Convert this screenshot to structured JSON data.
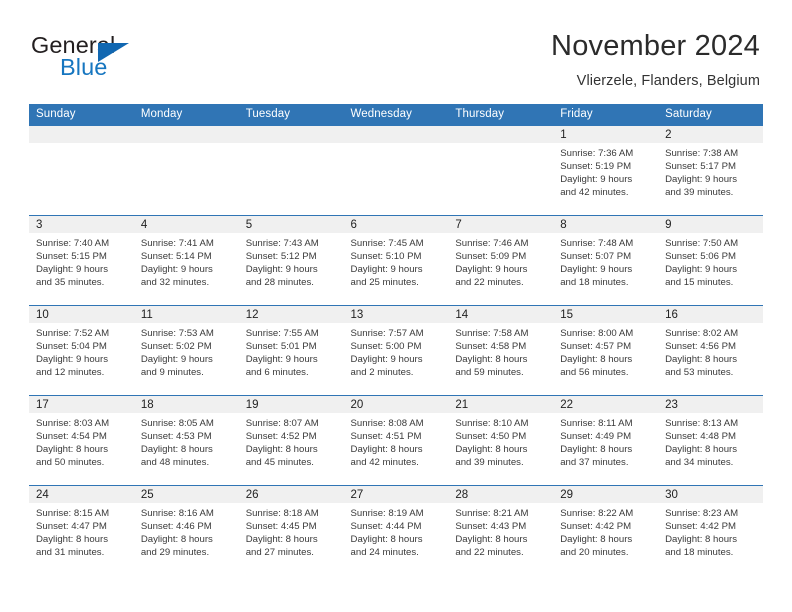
{
  "brand": {
    "name_top": "General",
    "name_bottom": "Blue",
    "triangle_icon": "blue-triangle-icon",
    "accent_color": "#1676c0"
  },
  "header": {
    "title": "November 2024",
    "location": "Vlierzele, Flanders, Belgium"
  },
  "theme": {
    "header_blue": "#3075b5",
    "day_band_gray": "#f0f0f0",
    "text_dark": "#231f20"
  },
  "calendar": {
    "weekday_headers": [
      "Sunday",
      "Monday",
      "Tuesday",
      "Wednesday",
      "Thursday",
      "Friday",
      "Saturday"
    ],
    "labels": {
      "sunrise": "Sunrise:",
      "sunset": "Sunset:",
      "daylight": "Daylight:"
    },
    "weeks": [
      [
        {
          "day": "",
          "lines": []
        },
        {
          "day": "",
          "lines": []
        },
        {
          "day": "",
          "lines": []
        },
        {
          "day": "",
          "lines": []
        },
        {
          "day": "",
          "lines": []
        },
        {
          "day": "1",
          "lines": [
            "Sunrise: 7:36 AM",
            "Sunset: 5:19 PM",
            "Daylight: 9 hours",
            "and 42 minutes."
          ]
        },
        {
          "day": "2",
          "lines": [
            "Sunrise: 7:38 AM",
            "Sunset: 5:17 PM",
            "Daylight: 9 hours",
            "and 39 minutes."
          ]
        }
      ],
      [
        {
          "day": "3",
          "lines": [
            "Sunrise: 7:40 AM",
            "Sunset: 5:15 PM",
            "Daylight: 9 hours",
            "and 35 minutes."
          ]
        },
        {
          "day": "4",
          "lines": [
            "Sunrise: 7:41 AM",
            "Sunset: 5:14 PM",
            "Daylight: 9 hours",
            "and 32 minutes."
          ]
        },
        {
          "day": "5",
          "lines": [
            "Sunrise: 7:43 AM",
            "Sunset: 5:12 PM",
            "Daylight: 9 hours",
            "and 28 minutes."
          ]
        },
        {
          "day": "6",
          "lines": [
            "Sunrise: 7:45 AM",
            "Sunset: 5:10 PM",
            "Daylight: 9 hours",
            "and 25 minutes."
          ]
        },
        {
          "day": "7",
          "lines": [
            "Sunrise: 7:46 AM",
            "Sunset: 5:09 PM",
            "Daylight: 9 hours",
            "and 22 minutes."
          ]
        },
        {
          "day": "8",
          "lines": [
            "Sunrise: 7:48 AM",
            "Sunset: 5:07 PM",
            "Daylight: 9 hours",
            "and 18 minutes."
          ]
        },
        {
          "day": "9",
          "lines": [
            "Sunrise: 7:50 AM",
            "Sunset: 5:06 PM",
            "Daylight: 9 hours",
            "and 15 minutes."
          ]
        }
      ],
      [
        {
          "day": "10",
          "lines": [
            "Sunrise: 7:52 AM",
            "Sunset: 5:04 PM",
            "Daylight: 9 hours",
            "and 12 minutes."
          ]
        },
        {
          "day": "11",
          "lines": [
            "Sunrise: 7:53 AM",
            "Sunset: 5:02 PM",
            "Daylight: 9 hours",
            "and 9 minutes."
          ]
        },
        {
          "day": "12",
          "lines": [
            "Sunrise: 7:55 AM",
            "Sunset: 5:01 PM",
            "Daylight: 9 hours",
            "and 6 minutes."
          ]
        },
        {
          "day": "13",
          "lines": [
            "Sunrise: 7:57 AM",
            "Sunset: 5:00 PM",
            "Daylight: 9 hours",
            "and 2 minutes."
          ]
        },
        {
          "day": "14",
          "lines": [
            "Sunrise: 7:58 AM",
            "Sunset: 4:58 PM",
            "Daylight: 8 hours",
            "and 59 minutes."
          ]
        },
        {
          "day": "15",
          "lines": [
            "Sunrise: 8:00 AM",
            "Sunset: 4:57 PM",
            "Daylight: 8 hours",
            "and 56 minutes."
          ]
        },
        {
          "day": "16",
          "lines": [
            "Sunrise: 8:02 AM",
            "Sunset: 4:56 PM",
            "Daylight: 8 hours",
            "and 53 minutes."
          ]
        }
      ],
      [
        {
          "day": "17",
          "lines": [
            "Sunrise: 8:03 AM",
            "Sunset: 4:54 PM",
            "Daylight: 8 hours",
            "and 50 minutes."
          ]
        },
        {
          "day": "18",
          "lines": [
            "Sunrise: 8:05 AM",
            "Sunset: 4:53 PM",
            "Daylight: 8 hours",
            "and 48 minutes."
          ]
        },
        {
          "day": "19",
          "lines": [
            "Sunrise: 8:07 AM",
            "Sunset: 4:52 PM",
            "Daylight: 8 hours",
            "and 45 minutes."
          ]
        },
        {
          "day": "20",
          "lines": [
            "Sunrise: 8:08 AM",
            "Sunset: 4:51 PM",
            "Daylight: 8 hours",
            "and 42 minutes."
          ]
        },
        {
          "day": "21",
          "lines": [
            "Sunrise: 8:10 AM",
            "Sunset: 4:50 PM",
            "Daylight: 8 hours",
            "and 39 minutes."
          ]
        },
        {
          "day": "22",
          "lines": [
            "Sunrise: 8:11 AM",
            "Sunset: 4:49 PM",
            "Daylight: 8 hours",
            "and 37 minutes."
          ]
        },
        {
          "day": "23",
          "lines": [
            "Sunrise: 8:13 AM",
            "Sunset: 4:48 PM",
            "Daylight: 8 hours",
            "and 34 minutes."
          ]
        }
      ],
      [
        {
          "day": "24",
          "lines": [
            "Sunrise: 8:15 AM",
            "Sunset: 4:47 PM",
            "Daylight: 8 hours",
            "and 31 minutes."
          ]
        },
        {
          "day": "25",
          "lines": [
            "Sunrise: 8:16 AM",
            "Sunset: 4:46 PM",
            "Daylight: 8 hours",
            "and 29 minutes."
          ]
        },
        {
          "day": "26",
          "lines": [
            "Sunrise: 8:18 AM",
            "Sunset: 4:45 PM",
            "Daylight: 8 hours",
            "and 27 minutes."
          ]
        },
        {
          "day": "27",
          "lines": [
            "Sunrise: 8:19 AM",
            "Sunset: 4:44 PM",
            "Daylight: 8 hours",
            "and 24 minutes."
          ]
        },
        {
          "day": "28",
          "lines": [
            "Sunrise: 8:21 AM",
            "Sunset: 4:43 PM",
            "Daylight: 8 hours",
            "and 22 minutes."
          ]
        },
        {
          "day": "29",
          "lines": [
            "Sunrise: 8:22 AM",
            "Sunset: 4:42 PM",
            "Daylight: 8 hours",
            "and 20 minutes."
          ]
        },
        {
          "day": "30",
          "lines": [
            "Sunrise: 8:23 AM",
            "Sunset: 4:42 PM",
            "Daylight: 8 hours",
            "and 18 minutes."
          ]
        }
      ]
    ]
  }
}
